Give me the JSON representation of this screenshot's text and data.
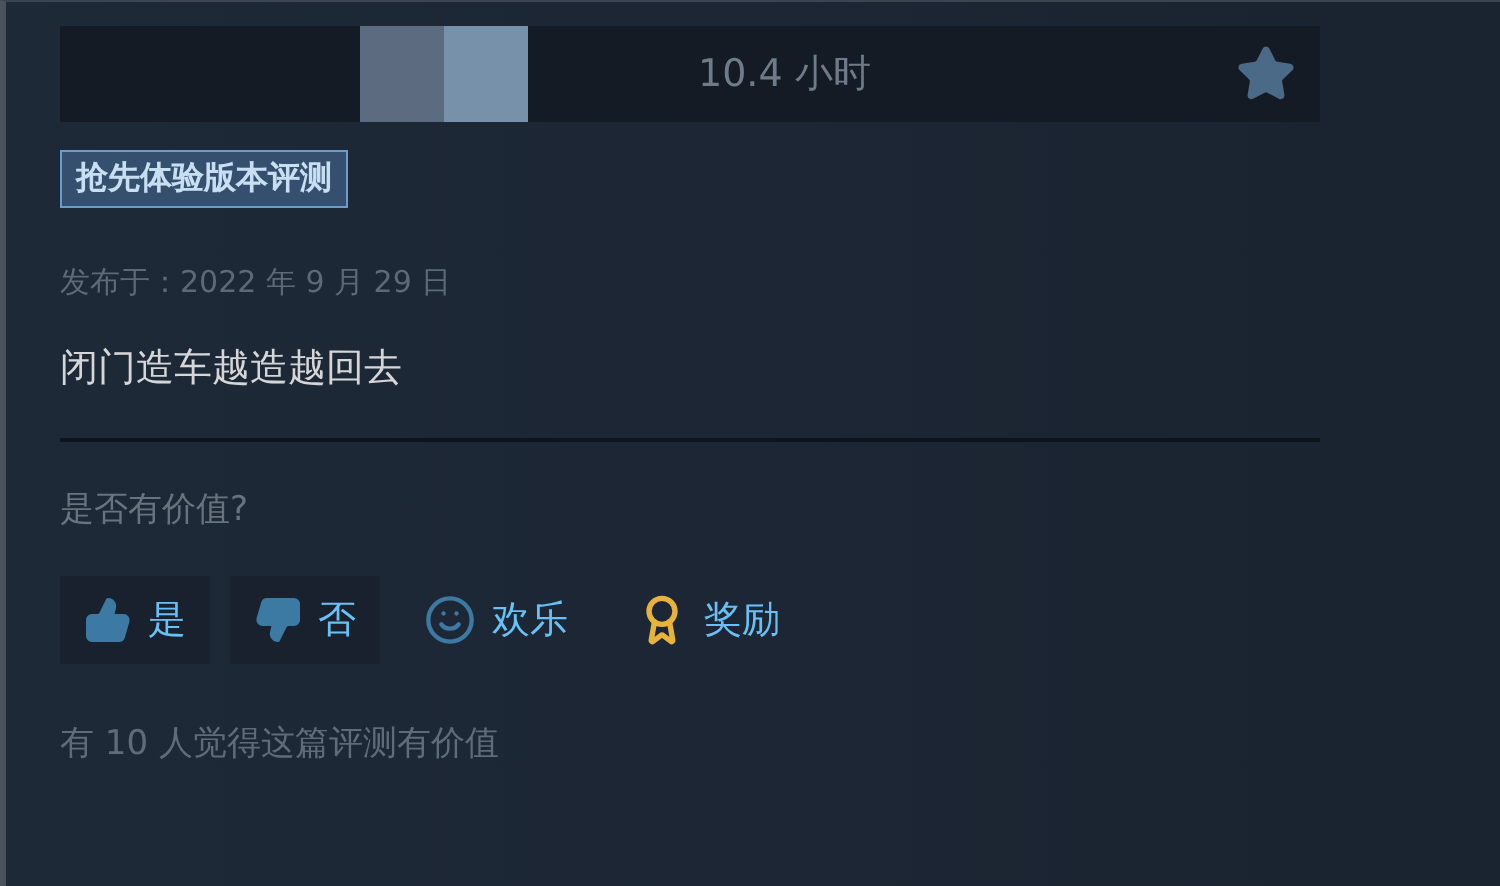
{
  "header": {
    "playtime": "10.4 小时"
  },
  "tag": "抢先体验版本评测",
  "posted": "发布于：2022 年 9 月 29 日",
  "review_text": "闭门造车越造越回去",
  "helpful": {
    "prompt": "是否有价值?",
    "buttons": [
      {
        "kind": "yes",
        "label": "是"
      },
      {
        "kind": "no",
        "label": "否"
      },
      {
        "kind": "funny",
        "label": "欢乐"
      },
      {
        "kind": "award",
        "label": "奖励"
      }
    ],
    "summary": "有 10 人觉得这篇评测有价值"
  }
}
